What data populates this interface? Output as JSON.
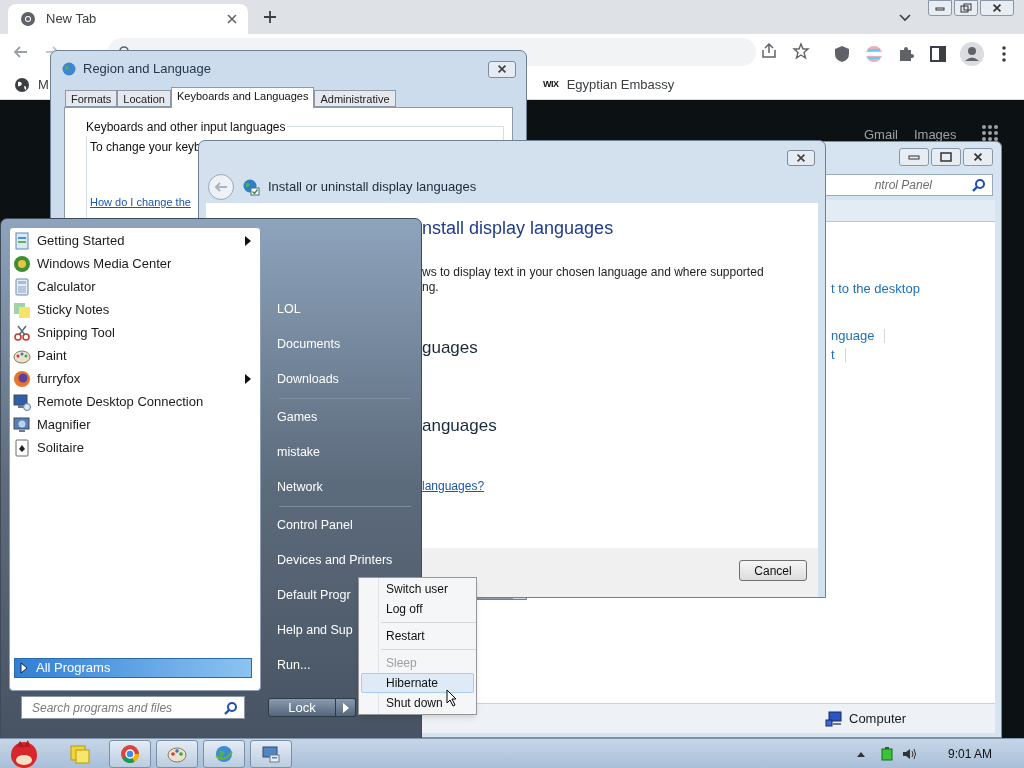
{
  "browser": {
    "tab": {
      "title": "New Tab"
    },
    "bookmarks": [
      {
        "label": "M",
        "kind": "globe"
      },
      {
        "label": "Egyptian Embassy",
        "kind": "text",
        "favicon_text": "WIX"
      }
    ],
    "page_links": [
      "Gmail",
      "Images"
    ]
  },
  "control_panel": {
    "search_placeholder": "ntrol Panel",
    "links": [
      {
        "text": "t to the desktop",
        "divider": false
      },
      {
        "text": "nguage",
        "divider": true
      },
      {
        "text": "t",
        "divider": true
      }
    ],
    "status_location": "Computer"
  },
  "region_dialog": {
    "title": "Region and Language",
    "tabs": [
      {
        "label": "Formats",
        "selected": false
      },
      {
        "label": "Location",
        "selected": false
      },
      {
        "label": "Keyboards and Languages",
        "selected": true
      },
      {
        "label": "Administrative",
        "selected": false
      }
    ],
    "group_title": "Keyboards and other input languages",
    "instructions": "To change your keyb",
    "help_link": "How do I change the"
  },
  "install_dialog": {
    "title": "Install or uninstall display languages",
    "heading": "nstall display languages",
    "description_lines": [
      "ws to display text in your chosen language and where supported",
      "ng."
    ],
    "sections": [
      "guages",
      "anguages"
    ],
    "link": "languages?",
    "cancel_button": "Cancel"
  },
  "start_menu": {
    "programs": [
      {
        "label": "Getting Started",
        "kind": "guide",
        "has_submenu": true
      },
      {
        "label": "Windows Media Center",
        "kind": "media",
        "has_submenu": false
      },
      {
        "label": "Calculator",
        "kind": "calculator",
        "has_submenu": false
      },
      {
        "label": "Sticky Notes",
        "kind": "notes",
        "has_submenu": false
      },
      {
        "label": "Snipping Tool",
        "kind": "snip",
        "has_submenu": false
      },
      {
        "label": "Paint",
        "kind": "paint",
        "has_submenu": false
      },
      {
        "label": "furryfox",
        "kind": "browser",
        "has_submenu": true
      },
      {
        "label": "Remote Desktop Connection",
        "kind": "remote",
        "has_submenu": false
      },
      {
        "label": "Magnifier",
        "kind": "magnifier",
        "has_submenu": false
      },
      {
        "label": "Solitaire",
        "kind": "cards",
        "has_submenu": false
      }
    ],
    "all_programs": {
      "label": "All Programs",
      "selected": true
    },
    "search_placeholder": "Search programs and files",
    "places": [
      {
        "label": "LOL",
        "separator_before": false
      },
      {
        "label": "Documents",
        "separator_before": false
      },
      {
        "label": "Downloads",
        "separator_before": false
      },
      {
        "label": "Games",
        "separator_before": true
      },
      {
        "label": "mistake",
        "separator_before": false
      },
      {
        "label": "Network",
        "separator_before": false
      },
      {
        "label": "Control Panel",
        "separator_before": true
      },
      {
        "label": "Devices and Printers",
        "separator_before": false
      },
      {
        "label": "Default Progr",
        "separator_before": false
      },
      {
        "label": "Help and Sup",
        "separator_before": false
      },
      {
        "label": "Run...",
        "separator_before": false
      }
    ],
    "lock_button": "Lock"
  },
  "power_menu": {
    "items": [
      {
        "label": "Switch user",
        "disabled": false,
        "selected": false,
        "separator_before": false
      },
      {
        "label": "Log off",
        "disabled": false,
        "selected": false,
        "separator_before": false
      },
      {
        "label": "Restart",
        "disabled": false,
        "selected": false,
        "separator_before": true
      },
      {
        "label": "Sleep",
        "disabled": true,
        "selected": false,
        "separator_before": true
      },
      {
        "label": "Hibernate",
        "disabled": false,
        "selected": true,
        "separator_before": false
      },
      {
        "label": "Shut down",
        "disabled": false,
        "selected": false,
        "separator_before": false
      }
    ]
  },
  "taskbar": {
    "tasks": [
      {
        "kind": "notes",
        "running": false
      },
      {
        "kind": "browser",
        "running": true
      },
      {
        "kind": "paint",
        "running": true
      },
      {
        "kind": "globe",
        "running": true
      },
      {
        "kind": "control",
        "running": true
      }
    ],
    "clock": "9:01 AM"
  }
}
